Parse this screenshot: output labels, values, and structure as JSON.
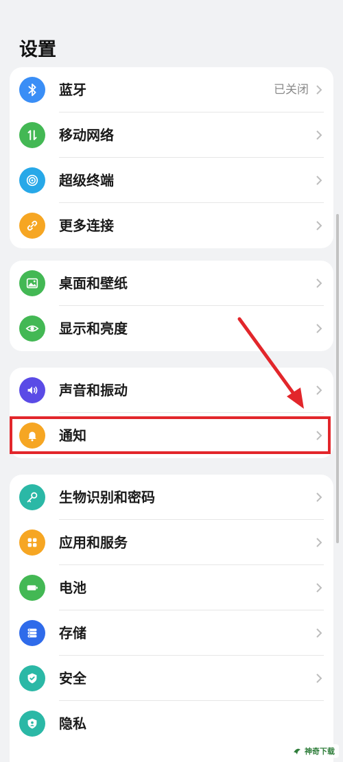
{
  "page": {
    "title": "设置"
  },
  "groups": [
    {
      "items": [
        {
          "label": "蓝牙",
          "value": "已关闭",
          "icon": "bluetooth-icon",
          "color": "#3a8ef6"
        },
        {
          "label": "移动网络",
          "icon": "mobile-network-icon",
          "color": "#43b854"
        },
        {
          "label": "超级终端",
          "icon": "super-device-icon",
          "color": "#27a8e8"
        },
        {
          "label": "更多连接",
          "icon": "link-icon",
          "color": "#f6a623"
        }
      ]
    },
    {
      "items": [
        {
          "label": "桌面和壁纸",
          "icon": "wallpaper-icon",
          "color": "#43b854"
        },
        {
          "label": "显示和亮度",
          "icon": "eye-icon",
          "color": "#43b854"
        }
      ]
    },
    {
      "items": [
        {
          "label": "声音和振动",
          "icon": "sound-icon",
          "color": "#5a4be6"
        },
        {
          "label": "通知",
          "icon": "bell-icon",
          "color": "#f6a623"
        }
      ]
    },
    {
      "items": [
        {
          "label": "生物识别和密码",
          "icon": "key-icon",
          "color": "#2bb8a6"
        },
        {
          "label": "应用和服务",
          "icon": "apps-icon",
          "color": "#f6a623"
        },
        {
          "label": "电池",
          "icon": "battery-icon",
          "color": "#43b854"
        },
        {
          "label": "存储",
          "icon": "storage-icon",
          "color": "#2f6bea"
        },
        {
          "label": "安全",
          "icon": "shield-check-icon",
          "color": "#2bb8a6"
        },
        {
          "label": "隐私",
          "icon": "privacy-icon",
          "color": "#2bb8a6"
        }
      ]
    }
  ],
  "annotation": {
    "highlight_color": "#e2262b"
  },
  "watermark": {
    "text": "神奇下载"
  }
}
